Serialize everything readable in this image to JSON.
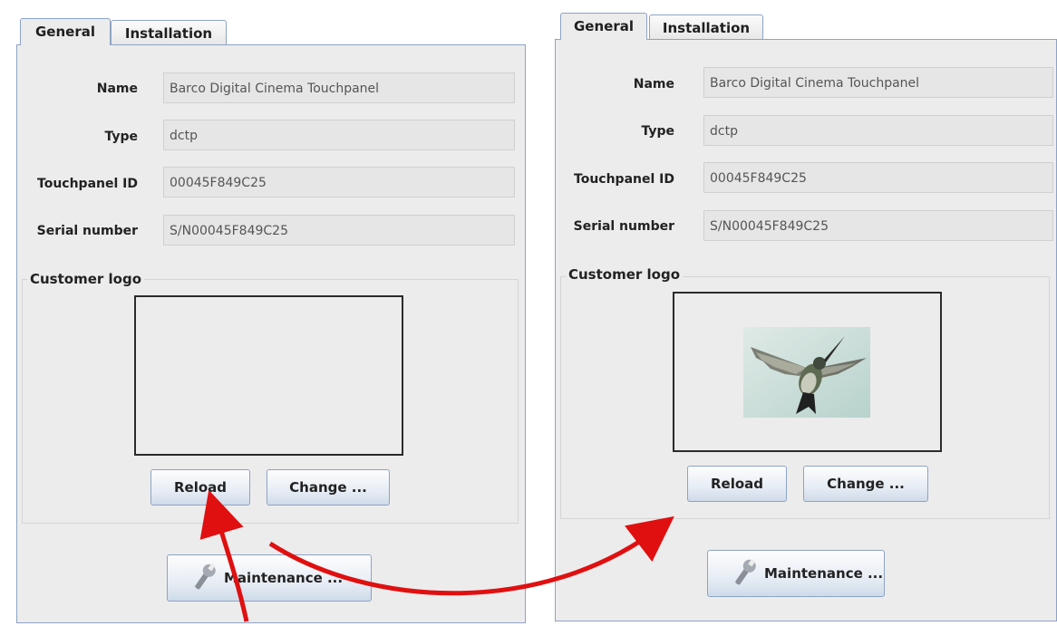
{
  "panels": [
    {
      "tabs": [
        "General",
        "Installation"
      ],
      "fields": [
        {
          "label": "Name",
          "value": "Barco Digital Cinema Touchpanel"
        },
        {
          "label": "Type",
          "value": "dctp"
        },
        {
          "label": "Touchpanel ID",
          "value": "00045F849C25"
        },
        {
          "label": "Serial number",
          "value": "S/N00045F849C25"
        }
      ],
      "logo_group_title": "Customer logo",
      "reload_label": "Reload",
      "change_label": "Change ...",
      "maintenance_label": "Maintenance ..."
    },
    {
      "tabs": [
        "General",
        "Installation"
      ],
      "fields": [
        {
          "label": "Name",
          "value": "Barco Digital Cinema Touchpanel"
        },
        {
          "label": "Type",
          "value": "dctp"
        },
        {
          "label": "Touchpanel ID",
          "value": "00045F849C25"
        },
        {
          "label": "Serial number",
          "value": "S/N00045F849C25"
        }
      ],
      "logo_group_title": "Customer logo",
      "logo_image": "hummingbird",
      "reload_label": "Reload",
      "change_label": "Change ...",
      "maintenance_label": "Maintenance ..."
    }
  ],
  "colors": {
    "annotation_arrow": "#e01010",
    "tab_border": "#8ea3c4",
    "panel_bg": "#ececec"
  }
}
